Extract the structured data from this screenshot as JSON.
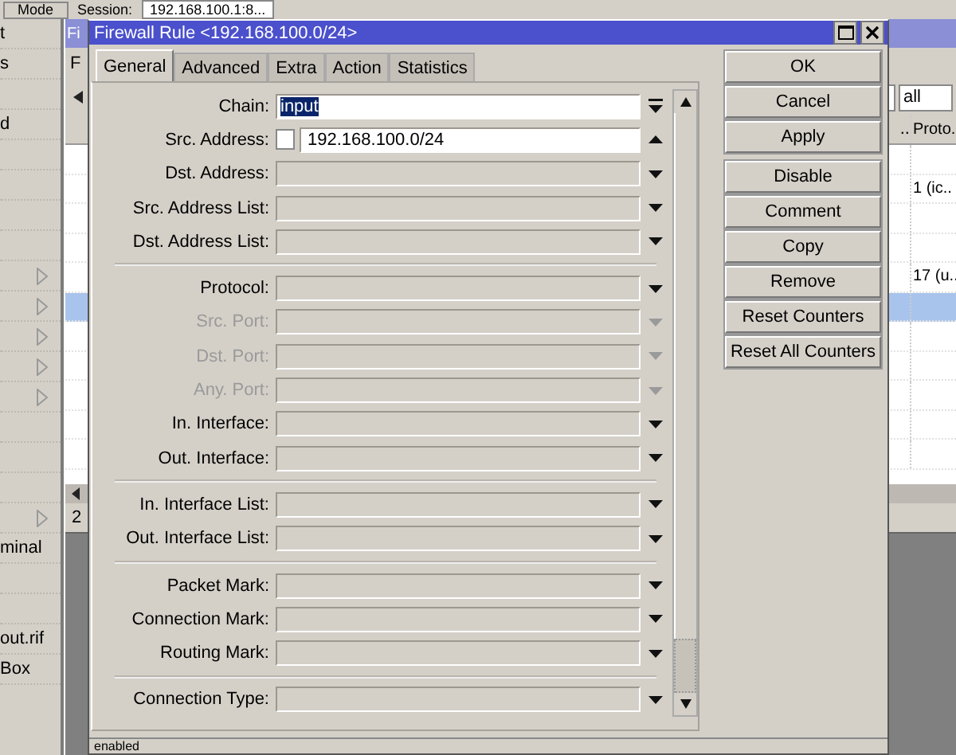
{
  "top_bar": {
    "mode_button": "Mode",
    "session_label": "Session:",
    "session_value": "192.168.100.1:8..."
  },
  "sidebar": {
    "items": [
      {
        "label": "t",
        "submenu": false
      },
      {
        "label": "s",
        "submenu": false
      },
      {
        "submenu": false
      },
      {
        "label": "d",
        "submenu": false
      },
      {
        "submenu": false
      },
      {
        "submenu": false
      },
      {
        "submenu": false
      },
      {
        "submenu": false
      },
      {
        "submenu": true
      },
      {
        "submenu": true
      },
      {
        "submenu": true
      },
      {
        "submenu": true
      },
      {
        "submenu": true
      },
      {
        "submenu": false
      },
      {
        "submenu": false
      },
      {
        "submenu": false
      },
      {
        "submenu": true
      },
      {
        "label": "minal",
        "submenu": false
      },
      {
        "submenu": false
      },
      {
        "submenu": false
      },
      {
        "label": "out.rif",
        "submenu": false
      },
      {
        "label": "Box",
        "submenu": false
      }
    ]
  },
  "back_window": {
    "title": "Fi",
    "tab": "F",
    "filter_value": "all",
    "status": "2",
    "table": {
      "columns": [
        "..",
        "Proto."
      ],
      "rows": [
        {
          "cells": [
            "",
            ""
          ],
          "selected": false
        },
        {
          "cells": [
            "",
            "1 (ic.."
          ],
          "selected": false
        },
        {
          "cells": [
            "",
            ""
          ],
          "selected": false
        },
        {
          "cells": [
            "",
            ""
          ],
          "selected": false
        },
        {
          "cells": [
            "",
            "17 (u.."
          ],
          "selected": false
        },
        {
          "cells": [
            "",
            ""
          ],
          "selected": true
        },
        {
          "cells": [
            "",
            ""
          ],
          "selected": false
        },
        {
          "cells": [
            "",
            ""
          ],
          "selected": false
        },
        {
          "cells": [
            "",
            ""
          ],
          "selected": false
        },
        {
          "cells": [
            "",
            ""
          ],
          "selected": false
        },
        {
          "cells": [
            "",
            ""
          ],
          "selected": false
        }
      ]
    }
  },
  "window": {
    "title": "Firewall Rule <192.168.100.0/24>",
    "tabs": [
      {
        "label": "General",
        "selected": true
      },
      {
        "label": "Advanced",
        "selected": false
      },
      {
        "label": "Extra",
        "selected": false
      },
      {
        "label": "Action",
        "selected": false
      },
      {
        "label": "Statistics",
        "selected": false
      }
    ],
    "field_groups": [
      [
        {
          "label": "Chain:",
          "kind": "select",
          "value": "input",
          "value_selected": true,
          "disabled": false
        },
        {
          "label": "Src. Address:",
          "kind": "negatable",
          "value": "192.168.100.0/24",
          "negated": false,
          "disabled": false
        },
        {
          "label": "Dst. Address:",
          "kind": "combo",
          "disabled": false
        },
        {
          "label": "Src. Address List:",
          "kind": "combo",
          "disabled": false
        },
        {
          "label": "Dst. Address List:",
          "kind": "combo",
          "disabled": false
        }
      ],
      [
        {
          "label": "Protocol:",
          "kind": "combo",
          "disabled": false
        },
        {
          "label": "Src. Port:",
          "kind": "combo",
          "disabled": true
        },
        {
          "label": "Dst. Port:",
          "kind": "combo",
          "disabled": true
        },
        {
          "label": "Any. Port:",
          "kind": "combo",
          "disabled": true
        },
        {
          "label": "In. Interface:",
          "kind": "combo",
          "disabled": false
        },
        {
          "label": "Out. Interface:",
          "kind": "combo",
          "disabled": false
        }
      ],
      [
        {
          "label": "In. Interface List:",
          "kind": "combo",
          "disabled": false
        },
        {
          "label": "Out. Interface List:",
          "kind": "combo",
          "disabled": false
        }
      ],
      [
        {
          "label": "Packet Mark:",
          "kind": "combo",
          "disabled": false
        },
        {
          "label": "Connection Mark:",
          "kind": "combo",
          "disabled": false
        },
        {
          "label": "Routing Mark:",
          "kind": "combo",
          "disabled": false
        }
      ],
      [
        {
          "label": "Connection Type:",
          "kind": "combo",
          "disabled": false
        }
      ]
    ],
    "button_groups": [
      [
        "OK",
        "Cancel",
        "Apply"
      ],
      [
        "Disable",
        "Comment",
        "Copy",
        "Remove",
        "Reset Counters",
        "Reset All Counters"
      ]
    ],
    "status": "enabled"
  }
}
